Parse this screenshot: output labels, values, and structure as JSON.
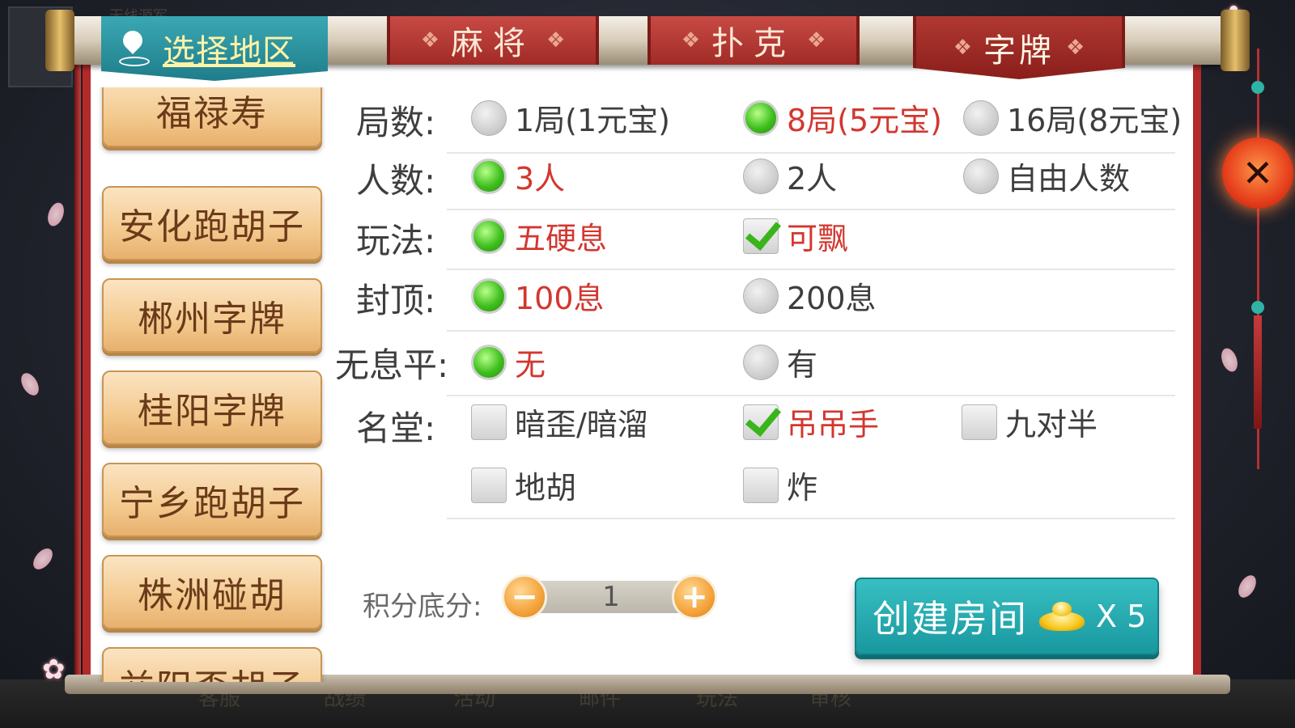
{
  "background": {
    "top_ghost_text": "无线源军",
    "bottom_nav": [
      "客服",
      "战绩",
      "活动",
      "邮件",
      "玩法",
      "审核"
    ]
  },
  "region_tab": {
    "label": "选择地区",
    "icon": "location-pin-icon"
  },
  "game_tabs": [
    {
      "label": "麻将",
      "active": false
    },
    {
      "label": "扑克",
      "active": false
    },
    {
      "label": "字牌",
      "active": true
    }
  ],
  "regions": [
    "福禄寿",
    "安化跑胡子",
    "郴州字牌",
    "桂阳字牌",
    "宁乡跑胡子",
    "株洲碰胡",
    "益阳歪胡子"
  ],
  "settings": {
    "rounds": {
      "label": "局数:",
      "options": [
        {
          "text": "1局(1元宝)",
          "selected": false
        },
        {
          "text": "8局(5元宝)",
          "selected": true
        },
        {
          "text": "16局(8元宝)",
          "selected": false
        }
      ]
    },
    "players": {
      "label": "人数:",
      "options": [
        {
          "text": "3人",
          "selected": true
        },
        {
          "text": "2人",
          "selected": false
        },
        {
          "text": "自由人数",
          "selected": false
        }
      ]
    },
    "play_style": {
      "label": "玩法:",
      "options": [
        {
          "text": "五硬息",
          "selected": true
        },
        {
          "text": "可飘",
          "selected": true
        }
      ]
    },
    "cap": {
      "label": "封顶:",
      "options": [
        {
          "text": "100息",
          "selected": true
        },
        {
          "text": "200息",
          "selected": false
        }
      ]
    },
    "no_points_tie": {
      "label": "无息平:",
      "options": [
        {
          "text": "无",
          "selected": true
        },
        {
          "text": "有",
          "selected": false
        }
      ]
    },
    "special_hands": {
      "label": "名堂:",
      "options": [
        {
          "text": "暗歪/暗溜",
          "selected": false
        },
        {
          "text": "吊吊手",
          "selected": true
        },
        {
          "text": "九对半",
          "selected": false
        },
        {
          "text": "地胡",
          "selected": false
        },
        {
          "text": "炸",
          "selected": false
        }
      ]
    }
  },
  "score": {
    "label": "积分底分:",
    "value": "1",
    "minus": "−",
    "plus": "+"
  },
  "create_room": {
    "label": "创建房间",
    "cost": "X 5"
  },
  "close": {
    "icon": "close-icon",
    "symbol": "✕"
  },
  "colors": {
    "accent_red": "#d2372f",
    "teal": "#1f9aa3",
    "tab_red": "#a12b27",
    "selected_green": "#3fbf1e"
  }
}
